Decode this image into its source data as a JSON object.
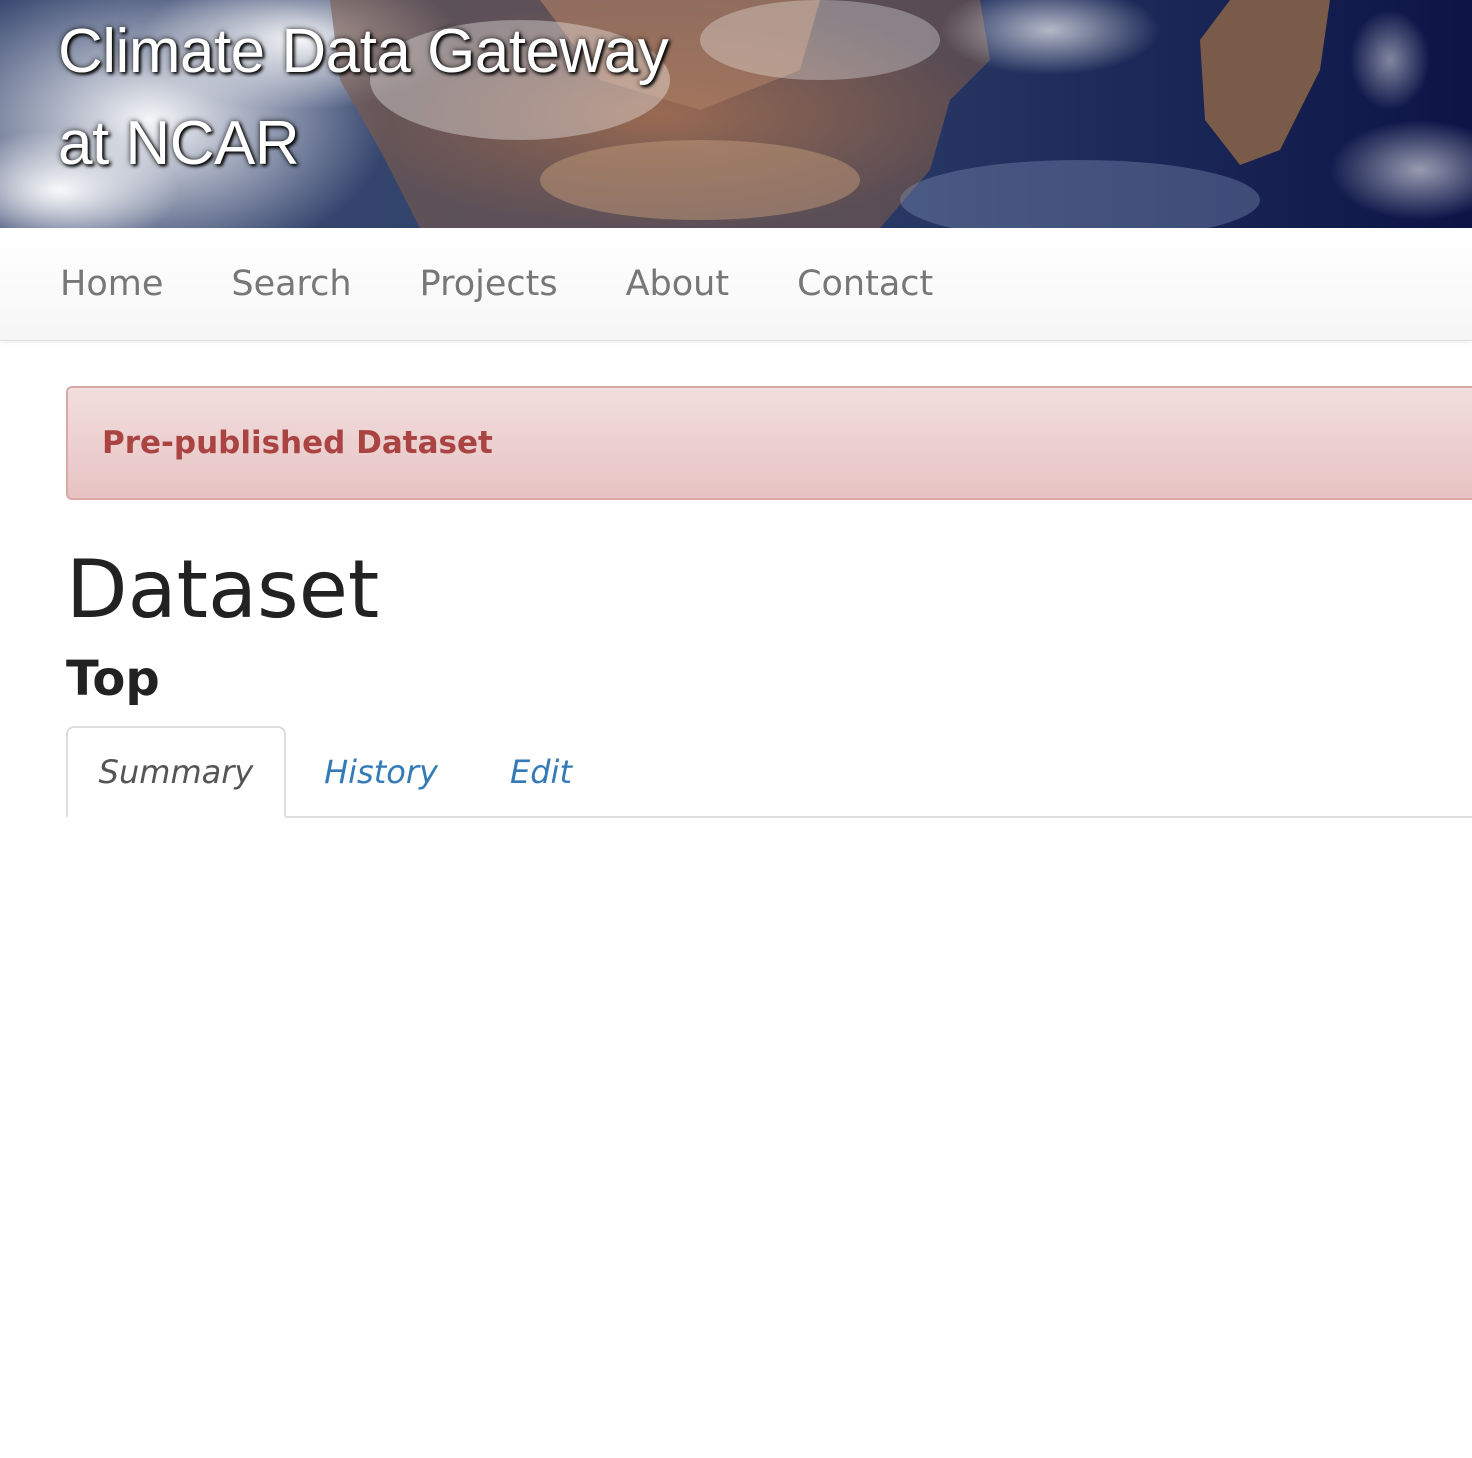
{
  "header": {
    "title_line1": "Climate Data Gateway",
    "title_line2": "at NCAR"
  },
  "nav": {
    "items": [
      {
        "label": "Home"
      },
      {
        "label": "Search"
      },
      {
        "label": "Projects"
      },
      {
        "label": "About"
      },
      {
        "label": "Contact"
      }
    ]
  },
  "alert": {
    "text": "Pre-published Dataset",
    "color": "#a94442",
    "background": "#f2dede"
  },
  "main": {
    "page_title": "Dataset",
    "section_title": "Top",
    "tabs": [
      {
        "label": "Summary",
        "active": true
      },
      {
        "label": "History",
        "active": false
      },
      {
        "label": "Edit",
        "active": false
      }
    ]
  },
  "colors": {
    "link": "#337ab7",
    "nav_text": "#777777",
    "text": "#222222"
  }
}
